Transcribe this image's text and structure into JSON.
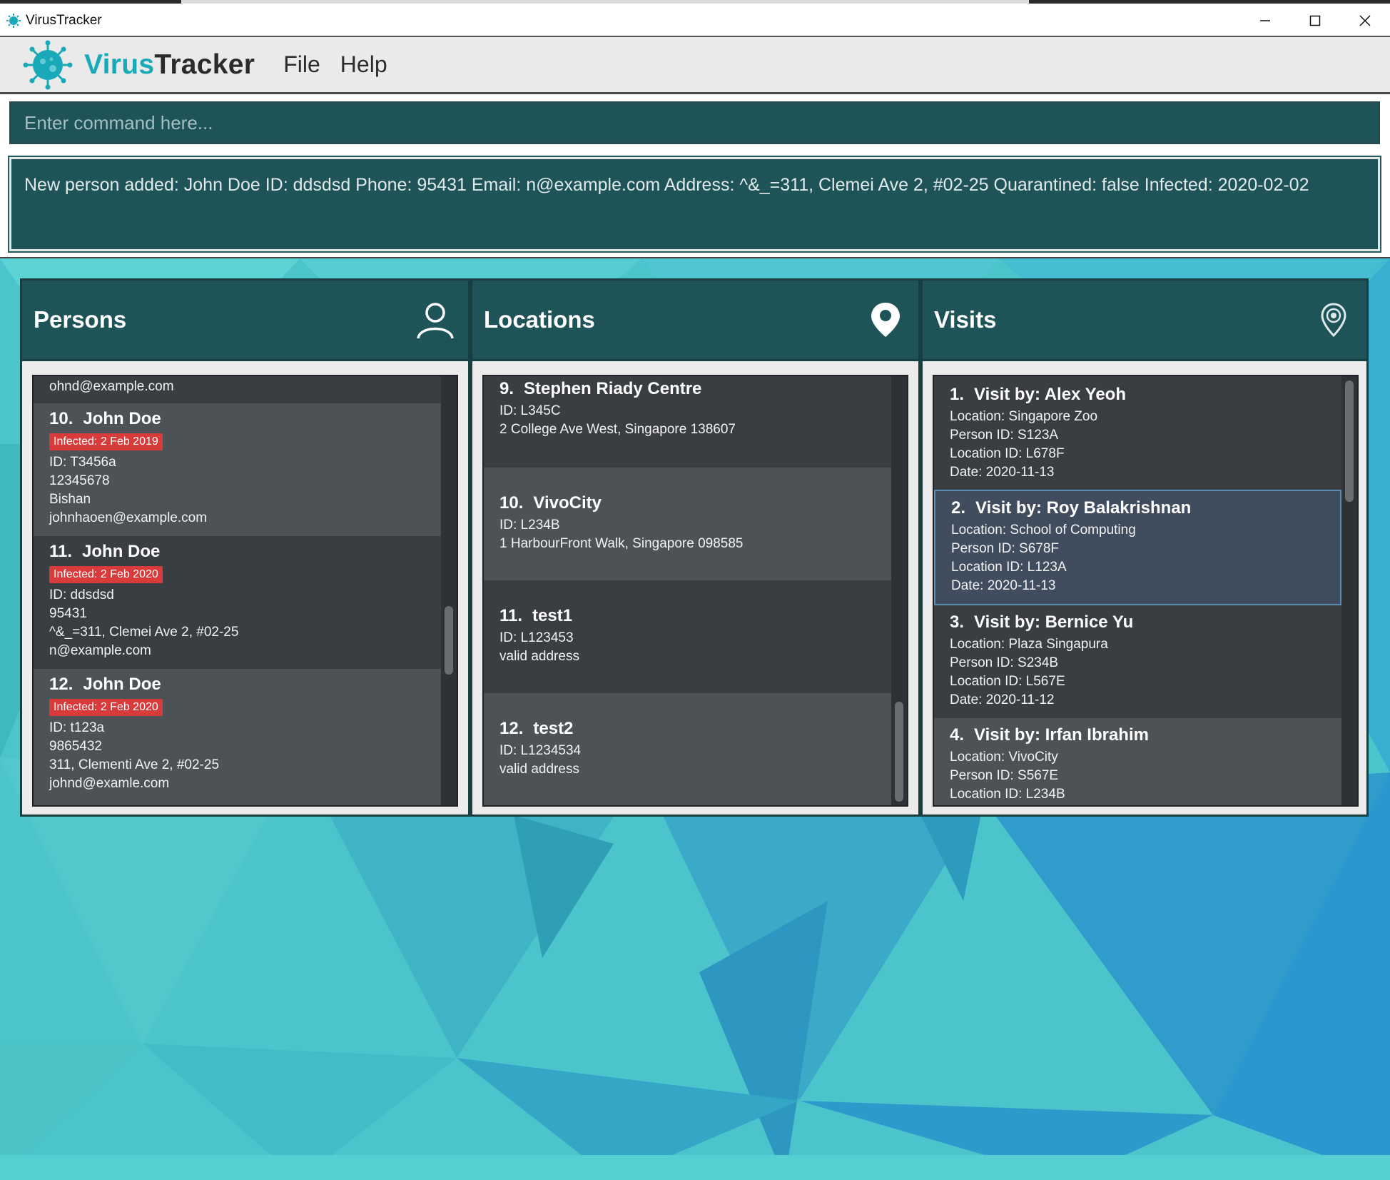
{
  "window": {
    "title": "VirusTracker"
  },
  "brand": {
    "part1": "Virus",
    "part2": "Tracker"
  },
  "menu": {
    "file": "File",
    "help": "Help"
  },
  "command": {
    "placeholder": "Enter command here..."
  },
  "result": {
    "text": "New person added: John Doe ID: ddsdsd Phone: 95431 Email: n@example.com Address: ^&_=311, Clemei Ave 2, #02-25 Quarantined: false Infected: 2020-02-02"
  },
  "colors": {
    "header_teal": "#1e5358",
    "brand_accent": "#1aa9b8",
    "infected_badge": "#d93a3a",
    "card_dark": "#3a3d41",
    "card_light": "#4d5257"
  },
  "persons": {
    "title": "Persons",
    "icon": "person-icon",
    "partial_email": "ohnd@example.com",
    "items": [
      {
        "index": "10.",
        "name": "John Doe",
        "badge": "Infected: 2 Feb 2019",
        "id": "ID: T3456a",
        "phone": "12345678",
        "address": "Bishan",
        "email": "johnhaoen@example.com"
      },
      {
        "index": "11.",
        "name": "John Doe",
        "badge": "Infected: 2 Feb 2020",
        "id": "ID: ddsdsd",
        "phone": "95431",
        "address": "^&_=311, Clemei Ave 2, #02-25",
        "email": "n@example.com"
      },
      {
        "index": "12.",
        "name": "John Doe",
        "badge": "Infected: 2 Feb 2020",
        "id": "ID: t123a",
        "phone": "9865432",
        "address": "311, Clementi Ave 2, #02-25",
        "email": "johnd@examle.com"
      }
    ]
  },
  "locations": {
    "title": "Locations",
    "icon": "location-pin-icon",
    "items": [
      {
        "index": "9.",
        "name": "Stephen Riady Centre",
        "id": "ID: L345C",
        "address": "2 College Ave West, Singapore 138607"
      },
      {
        "index": "10.",
        "name": "VivoCity",
        "id": "ID: L234B",
        "address": "1 HarbourFront Walk, Singapore 098585"
      },
      {
        "index": "11.",
        "name": "test1",
        "id": "ID: L123453",
        "address": "valid address"
      },
      {
        "index": "12.",
        "name": "test2",
        "id": "ID: L1234534",
        "address": "valid  address"
      }
    ]
  },
  "visits": {
    "title": "Visits",
    "icon": "visit-pin-icon",
    "items": [
      {
        "index": "1.",
        "title": "Visit by: Alex Yeoh",
        "location": "Location: Singapore Zoo",
        "person_id": "Person ID: S123A",
        "location_id": "Location ID: L678F",
        "date": "Date: 2020-11-13"
      },
      {
        "index": "2.",
        "title": "Visit by: Roy Balakrishnan",
        "location": "Location: School of Computing",
        "person_id": "Person ID: S678F",
        "location_id": "Location ID: L123A",
        "date": "Date: 2020-11-13"
      },
      {
        "index": "3.",
        "title": "Visit by: Bernice Yu",
        "location": "Location: Plaza Singapura",
        "person_id": "Person ID: S234B",
        "location_id": "Location ID: L567E",
        "date": "Date: 2020-11-12"
      },
      {
        "index": "4.",
        "title": "Visit by: Irfan Ibrahim",
        "location": "Location: VivoCity",
        "person_id": "Person ID: S567E",
        "location_id": "Location ID: L234B",
        "date": ""
      }
    ]
  }
}
